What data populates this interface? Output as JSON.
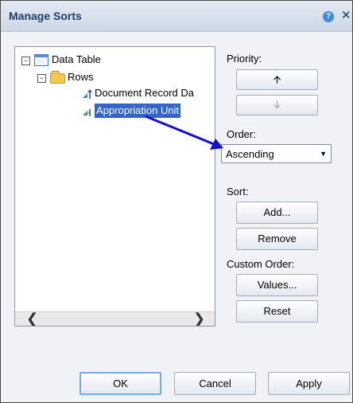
{
  "dialog": {
    "title": "Manage Sorts",
    "help_glyph": "?",
    "close_glyph": "✕"
  },
  "tree": {
    "items": [
      {
        "label": "Data Table",
        "expander": "−",
        "icon": "table-icon"
      },
      {
        "label": "Rows",
        "expander": "−",
        "icon": "folder-icon"
      },
      {
        "label": "Document Record Da",
        "icon": "sort-ascending-icon"
      },
      {
        "label": "Appropriation Unit",
        "icon": "sort-ascending-icon",
        "selected": true
      }
    ],
    "scroll_left": "❮",
    "scroll_right": "❯"
  },
  "priority": {
    "label": "Priority:",
    "up_glyph": "🡩",
    "down_glyph": "🡫"
  },
  "order": {
    "label": "Order:",
    "value": "Ascending",
    "options": [
      "Ascending"
    ]
  },
  "sort": {
    "label": "Sort:",
    "add_label": "Add...",
    "remove_label": "Remove"
  },
  "custom_order": {
    "label": "Custom Order:",
    "values_label": "Values...",
    "reset_label": "Reset"
  },
  "footer": {
    "ok_label": "OK",
    "cancel_label": "Cancel",
    "apply_label": "Apply"
  },
  "colors": {
    "selection": "#3166c7",
    "annotation_arrow": "#1010d0",
    "title_text": "#1f3e66"
  }
}
